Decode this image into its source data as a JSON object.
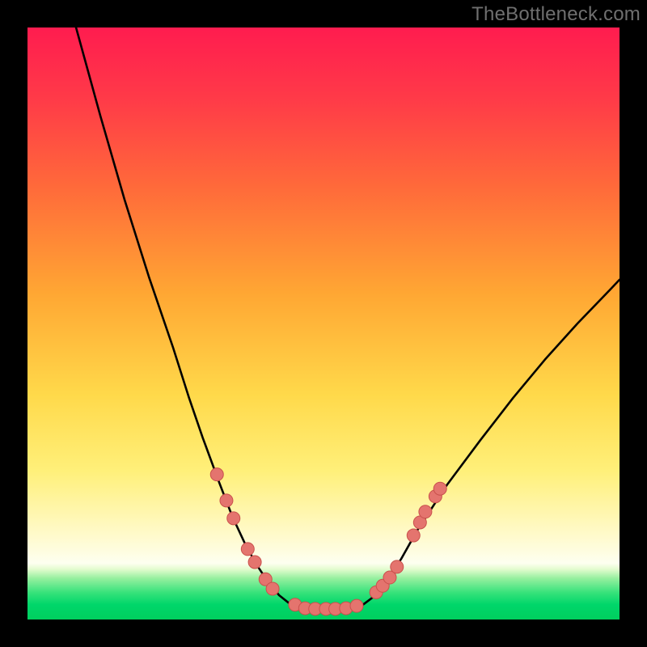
{
  "watermark": "TheBottleneck.com",
  "colors": {
    "frame": "#000000",
    "curve": "#000000",
    "marker_fill": "#e4746e",
    "marker_stroke": "#c9514c",
    "gradient_top": "#ff1c4f",
    "gradient_bottom": "#00cf5e"
  },
  "chart_data": {
    "type": "line",
    "title": "",
    "xlabel": "",
    "ylabel": "",
    "xlim": [
      0,
      100
    ],
    "ylim": [
      0,
      100
    ],
    "grid": false,
    "legend": false,
    "note": "Axes are unlabeled in the image; values below are px→percent estimates from a 732×732 plot area. y=0 is bottom.",
    "series": [
      {
        "name": "left-curve",
        "x": [
          8.2,
          12.3,
          16.4,
          20.5,
          24.6,
          27.3,
          29.6,
          32.4,
          34.6,
          36.6,
          38.6,
          40.6,
          42.5,
          44.5,
          46.5
        ],
        "y": [
          100.0,
          85.1,
          70.9,
          57.9,
          45.9,
          37.4,
          30.7,
          23.1,
          17.4,
          13.1,
          9.4,
          6.4,
          4.1,
          2.5,
          1.6
        ]
      },
      {
        "name": "valley-floor",
        "x": [
          46.5,
          48.5,
          50.4,
          52.5,
          54.4
        ],
        "y": [
          1.6,
          1.5,
          1.5,
          1.5,
          1.6
        ]
      },
      {
        "name": "right-curve",
        "x": [
          54.4,
          56.4,
          58.4,
          60.4,
          63.1,
          65.8,
          70.9,
          76.5,
          82.0,
          87.4,
          92.9,
          98.4,
          100.0
        ],
        "y": [
          1.6,
          2.3,
          3.8,
          6.1,
          10.2,
          15.0,
          22.8,
          30.3,
          37.4,
          43.9,
          50.0,
          55.7,
          57.4
        ]
      }
    ],
    "markers": {
      "name": "highlight-points",
      "points": [
        {
          "x": 32.0,
          "y": 24.5
        },
        {
          "x": 33.6,
          "y": 20.1
        },
        {
          "x": 34.8,
          "y": 17.1
        },
        {
          "x": 37.2,
          "y": 11.9
        },
        {
          "x": 38.4,
          "y": 9.7
        },
        {
          "x": 40.2,
          "y": 6.8
        },
        {
          "x": 41.4,
          "y": 5.2
        },
        {
          "x": 45.2,
          "y": 2.5
        },
        {
          "x": 46.9,
          "y": 1.9
        },
        {
          "x": 48.6,
          "y": 1.8
        },
        {
          "x": 50.4,
          "y": 1.8
        },
        {
          "x": 52.0,
          "y": 1.8
        },
        {
          "x": 53.8,
          "y": 1.9
        },
        {
          "x": 55.6,
          "y": 2.3
        },
        {
          "x": 58.9,
          "y": 4.6
        },
        {
          "x": 60.0,
          "y": 5.7
        },
        {
          "x": 61.2,
          "y": 7.1
        },
        {
          "x": 62.4,
          "y": 8.9
        },
        {
          "x": 65.2,
          "y": 14.2
        },
        {
          "x": 66.3,
          "y": 16.4
        },
        {
          "x": 67.2,
          "y": 18.2
        },
        {
          "x": 68.9,
          "y": 20.8
        },
        {
          "x": 69.7,
          "y": 22.1
        }
      ]
    }
  }
}
